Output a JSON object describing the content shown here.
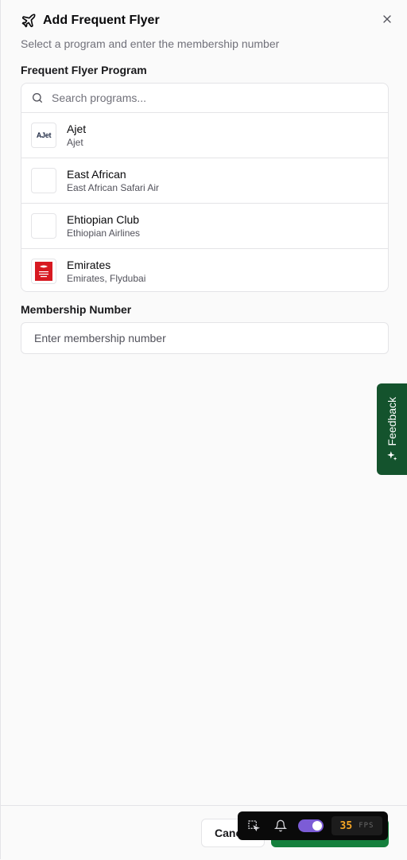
{
  "dialog": {
    "title": "Add Frequent Flyer",
    "subtitle": "Select a program and enter the membership number",
    "close_icon": "close-icon",
    "title_icon": "plane-icon"
  },
  "program": {
    "label": "Frequent Flyer Program",
    "search_placeholder": "Search programs...",
    "items": [
      {
        "name": "Ajet",
        "subtitle": "Ajet",
        "logo": "ajet-logo",
        "logo_text": "AJet"
      },
      {
        "name": "East African",
        "subtitle": "East African Safari Air",
        "logo": "blank-logo"
      },
      {
        "name": "Ehtiopian Club",
        "subtitle": "Ethiopian Airlines",
        "logo": "blank-logo"
      },
      {
        "name": "Emirates",
        "subtitle": "Emirates, Flydubai",
        "logo": "emirates-logo"
      }
    ]
  },
  "membership": {
    "label": "Membership Number",
    "placeholder": "Enter membership number"
  },
  "feedback": {
    "label": "Feedback"
  },
  "footer": {
    "cancel_label": "Canc"
  },
  "devtools": {
    "fps_value": "35",
    "fps_unit": "FPS"
  },
  "colors": {
    "accent": "#15803d",
    "feedback_bg": "#14532d",
    "toggle": "#7c5cd6",
    "fps": "#f5a524"
  }
}
